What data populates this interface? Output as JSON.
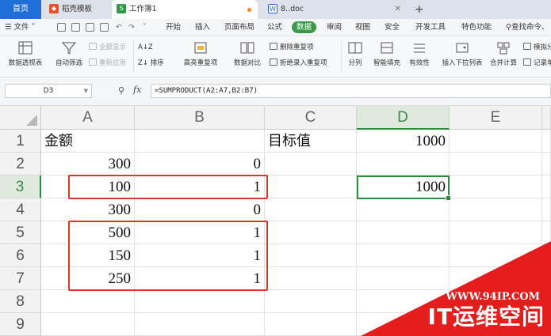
{
  "tabs": {
    "home": "首页",
    "templates": "稻壳模板",
    "workbook": "工作簿1",
    "doc": "8..doc",
    "new": "+"
  },
  "menu": {
    "file": "文件",
    "items": [
      "开始",
      "插入",
      "页面布局",
      "公式",
      "数据",
      "审阅",
      "视图",
      "安全",
      "开发工具",
      "特色功能"
    ],
    "active": "数据",
    "search": "查找命令、"
  },
  "ribbon": {
    "pivot": "数据透视表",
    "autofilter": "自动筛选",
    "show_all": "全部显示",
    "reapply": "重新应用",
    "sort": "排序",
    "highlight_dup": "高亮重复项",
    "compare": "数据对比",
    "remove_dup": "删除重复项",
    "reject_dup": "拒绝录入重复项",
    "split": "分列",
    "smart_fill": "智能填充",
    "validity": "有效性",
    "insert_dropdown": "插入下拉列表",
    "consolidate": "合并计算",
    "simulate": "模拟分",
    "record": "记录单"
  },
  "formula_bar": {
    "cell_ref": "D3",
    "fx": "fx",
    "formula": "=SUMPRODUCT(A2:A7,B2:B7)"
  },
  "sheet": {
    "columns": [
      "A",
      "B",
      "C",
      "D",
      "E"
    ],
    "selected_column": "D",
    "rows": [
      "1",
      "2",
      "3",
      "4",
      "5",
      "6",
      "7",
      "8",
      "9"
    ],
    "selected_row": "3",
    "cells": {
      "A1": "金额",
      "C1": "目标值",
      "D1": "1000",
      "A2": "300",
      "B2": "0",
      "A3": "100",
      "B3": "1",
      "D3": "1000",
      "A4": "300",
      "B4": "0",
      "A5": "500",
      "B5": "1",
      "A6": "150",
      "B6": "1",
      "A7": "250",
      "B7": "1"
    },
    "active_cell": "D3"
  },
  "watermark": {
    "url": "WWW.94IP.COM",
    "name": "IT运维空间"
  },
  "colors": {
    "home_tab": "#1f6fd9",
    "accent_green": "#2e8b3d",
    "highlight_red": "#e0342c",
    "watermark_red": "#e51d1d"
  }
}
